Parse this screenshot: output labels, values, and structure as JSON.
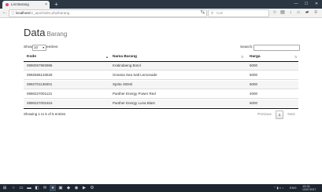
{
  "browser": {
    "tab_title": "List Barang",
    "tab_close": "×",
    "new_tab": "+",
    "url_host": "localhost",
    "url_path": "/ci_apo/index.php/barang",
    "search_placeholder": "Cari",
    "colors": {
      "tab_strip": "#2b3743",
      "favicon": "#e0457b"
    }
  },
  "page": {
    "title": "Data",
    "subtitle": "Barang",
    "length": {
      "label_before": "Show",
      "value": "10",
      "label_after": "entries"
    },
    "search_label": "Search:",
    "columns": [
      "Kode",
      "Nama Barang",
      "Harga"
    ],
    "rows": [
      {
        "kode": "0890057993985",
        "nama": "Kratindaeng Botol",
        "harga": "5000"
      },
      {
        "kode": "0892566133526",
        "nama": "Oceana Sea Salt Lemonade",
        "harga": "5000"
      },
      {
        "kode": "0892701136001",
        "nama": "Sprite 250ml",
        "harga": "6000"
      },
      {
        "kode": "0890227001121",
        "nama": "Panther Energy Power Red",
        "harga": "4000"
      },
      {
        "kode": "0890227001916",
        "nama": "Panther Energy Luna Blast",
        "harga": "6000"
      }
    ],
    "info": "Showing 1 to 5 of 5 entries",
    "pagination": {
      "previous": "Previous",
      "current": "1",
      "next": "Next"
    }
  },
  "taskbar": {
    "icons": [
      "windows-icon",
      "search-icon",
      "task-view-icon",
      "firefox-icon",
      "folder-icon",
      "store-icon",
      "terminal-icon",
      "editor-icon",
      "chrome-icon",
      "media-icon",
      "settings-icon"
    ],
    "language": "ENG",
    "time": "15:31",
    "date": "13/07/2017"
  }
}
